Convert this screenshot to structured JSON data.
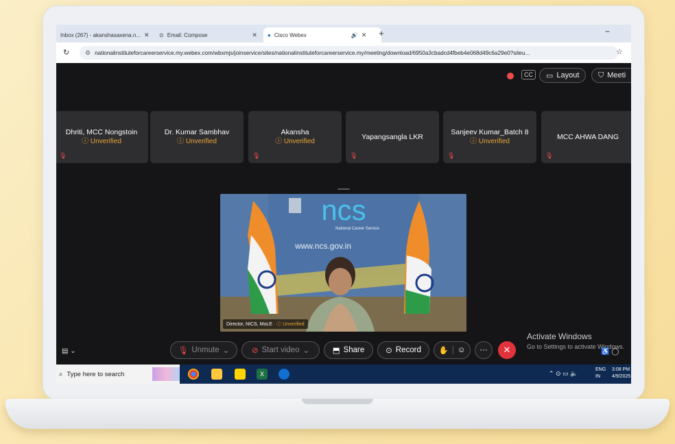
{
  "browser": {
    "tabs": [
      {
        "label": "Inbox (267) - akanshasaxena.n..."
      },
      {
        "label": "Email: Compose"
      },
      {
        "label": "Cisco Webex"
      }
    ],
    "new_tab": "+",
    "minimize": "−",
    "url": "nationalinstituteforcareerservice.my.webex.com/wbxmjs/joinservice/sites/nationalinstituteforcareerservice.my/meeting/download/6950a3cbadcd4fbeb4e068d49c6a29e0?siteu..."
  },
  "webex": {
    "cc_label": "CC",
    "layout_label": "Layout",
    "meeting_label": "Meeti",
    "participants": [
      {
        "name": "Dhriti, MCC Nongstoin",
        "status": "Unverified"
      },
      {
        "name": "Dr. Kumar Sambhav",
        "status": "Unverified"
      },
      {
        "name": "Akansha",
        "status": "Unverified"
      },
      {
        "name": "Yapangsangla LKR",
        "status": ""
      },
      {
        "name": "Sanjeev Kumar_Batch 8",
        "status": "Unverified"
      },
      {
        "name": "MCC AHWA DANG",
        "status": ""
      }
    ],
    "video": {
      "speaker_label": "Director, NICS, MoLE",
      "speaker_status": "Unverified",
      "banner_text": "ncs",
      "banner_sub": "National Career Service",
      "banner_url": "www.ncs.gov.in"
    },
    "controls": {
      "unmute": "Unmute",
      "start_video": "Start video",
      "share": "Share",
      "record": "Record"
    },
    "watermark": {
      "title": "Activate Windows",
      "subtitle": "Go to Settings to activate Windows."
    }
  },
  "taskbar": {
    "search_placeholder": "Type here to search",
    "lang_top": "ENG",
    "lang_bottom": "IN",
    "time": "3:08 PM",
    "date": "4/9/2025"
  },
  "colors": {
    "background": "#f9e4ab",
    "meeting_bg": "#151517",
    "tile_bg": "#2e2e31",
    "unverified": "#e8a536",
    "end_call": "#e0333b",
    "taskbar": "#0e2a52"
  }
}
